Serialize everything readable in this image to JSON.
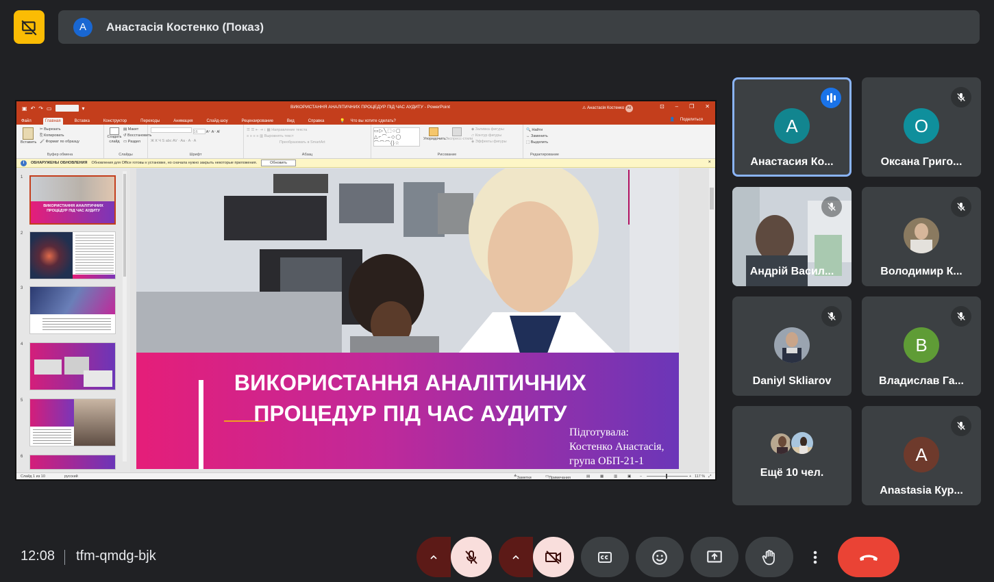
{
  "header": {
    "presenting_icon": "present-off-icon",
    "presenter_initial": "A",
    "presenter_label": "Анастасія Костенко (Показ)"
  },
  "ppt": {
    "doc_title": "ВИКОРИСТАННЯ АНАЛІТИЧНИХ ПРОЦЕДУР ПІД ЧАС АУДИТУ  -  PowerPoint",
    "user": "Анастасія Костенко",
    "user_initials": "АК",
    "tabs": [
      "Файл",
      "Главная",
      "Вставка",
      "Конструктор",
      "Переходы",
      "Анимация",
      "Слайд-шоу",
      "Рецензирование",
      "Вид",
      "Справка",
      "Что вы хотите сделать?"
    ],
    "share": "Поделиться",
    "ribbon": {
      "clipboard": {
        "label": "Буфер обмена",
        "paste": "Вставить",
        "cut": "Вырезать",
        "copy": "Копировать",
        "format": "Формат по образцу"
      },
      "slides": {
        "label": "Слайды",
        "new_slide": "Создать слайд",
        "layout": "Макет",
        "reset": "Восстановить",
        "section": "Раздел"
      },
      "font": {
        "label": "Шрифт",
        "size": "16"
      },
      "paragraph": {
        "label": "Абзац",
        "text_dir": "Направление текста",
        "align_text": "Выровнять текст",
        "smartart": "Преобразовать в SmartArt"
      },
      "drawing": {
        "label": "Рисование",
        "arrange": "Упорядочить",
        "quick_styles": "Экспресс-стили",
        "fill": "Заливка фигуры",
        "outline": "Контур фигуры",
        "effects": "Эффекты фигуры"
      },
      "editing": {
        "label": "Редактирование",
        "find": "Найти",
        "replace": "Заменить",
        "select": "Выделить"
      }
    },
    "update_bar": {
      "title": "ОБНАРУЖЕНЫ ОБНОВЛЕНИЯ",
      "message": "Обновления для Office готовы к установке, но сначала нужно закрыть некоторые приложения.",
      "button": "Обновить"
    },
    "thumb_numbers": [
      "1",
      "2",
      "3",
      "4",
      "5",
      "6"
    ],
    "thumb1_title": "ВИКОРИСТАННЯ АНАЛІТИЧНИХ ПРОЦЕДУР ПІД ЧАС АУДИТУ",
    "slide": {
      "title_line1": "ВИКОРИСТАННЯ АНАЛІТИЧНИХ",
      "title_line2": "ПРОЦЕДУР ПІД ЧАС АУДИТУ",
      "sub1": "Підготувала:",
      "sub2": "Костенко Анастасія,",
      "sub3": "група ОБП-21-1"
    },
    "status": {
      "slide_of": "Слайд 1 из 10",
      "lang": "русский",
      "notes": "Заметки",
      "comments": "Примечания",
      "zoom": "117 %"
    }
  },
  "participants": [
    {
      "name": "Анастасия Ко...",
      "initial": "A",
      "color": "#12858f",
      "state": "speaking"
    },
    {
      "name": "Оксана Григо...",
      "initial": "О",
      "color": "#0f8f9c",
      "state": "muted"
    },
    {
      "name": "Андрій Васил...",
      "state": "video-muted"
    },
    {
      "name": "Володимир К...",
      "state": "photo-muted"
    },
    {
      "name": "Daniyl Skliarov",
      "state": "photo-muted"
    },
    {
      "name": "Владислав Га...",
      "initial": "В",
      "color": "#5f9c36",
      "state": "muted"
    },
    {
      "name": "Ещё 10 чел.",
      "state": "more"
    },
    {
      "name": "Anastasia Кур...",
      "initial": "A",
      "color": "#6e3a2c",
      "state": "muted"
    }
  ],
  "footer": {
    "time": "12:08",
    "meeting_code": "tfm-qmdg-bjk"
  },
  "controls": [
    "mic-options-chevron",
    "mic-off",
    "camera-options-chevron",
    "camera-off",
    "captions",
    "reactions",
    "present-now",
    "raise-hand",
    "more-options",
    "leave-call"
  ]
}
